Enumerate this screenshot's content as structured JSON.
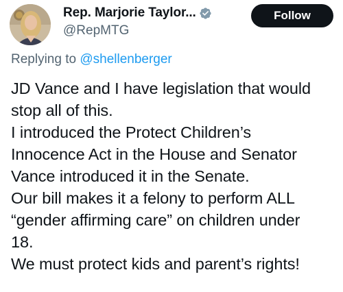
{
  "author": {
    "display_name": "Rep. Marjorie Taylor...",
    "handle": "@RepMTG",
    "avatar_icon": "profile-photo",
    "verified_icon": "verified-badge-icon",
    "verified_color": "#829aab"
  },
  "follow_button": {
    "label": "Follow"
  },
  "reply": {
    "prefix": "Replying to",
    "mention": "@shellenberger"
  },
  "tweet_lines": [
    "JD Vance and I have legislation that would",
    "stop all of this.",
    "I introduced the Protect Children’s",
    "Innocence Act in the House and Senator",
    "Vance introduced it in the Senate.",
    "Our bill makes it a felony to perform ALL",
    "“gender affirming care” on children under",
    "18.",
    "We must protect kids and parent’s rights!"
  ],
  "colors": {
    "text": "#0f1419",
    "secondary": "#536471",
    "link": "#1d9bf0",
    "button_bg": "#0f1419"
  }
}
